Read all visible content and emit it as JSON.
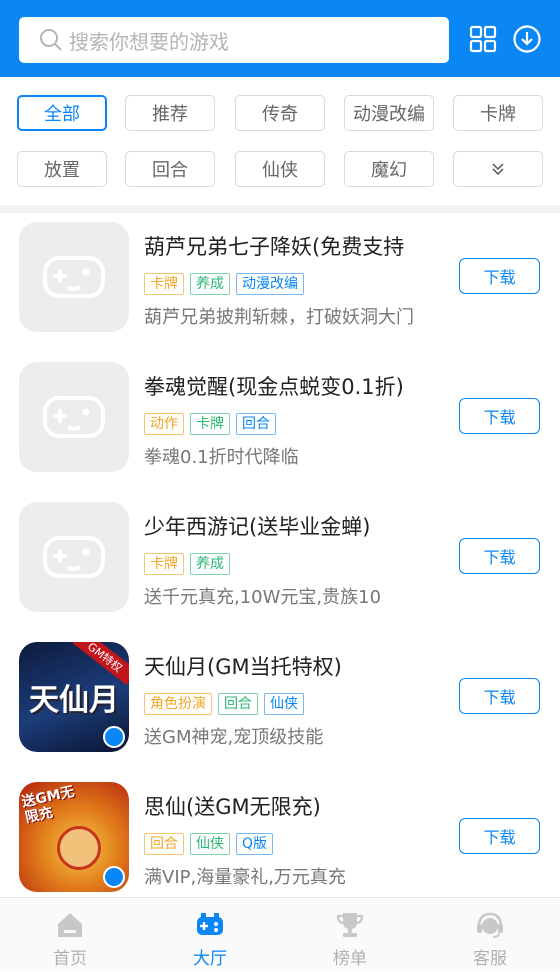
{
  "search": {
    "placeholder": "搜索你想要的游戏"
  },
  "filters": [
    "全部",
    "推荐",
    "传奇",
    "动漫改编",
    "卡牌",
    "放置",
    "回合",
    "仙侠",
    "魔幻"
  ],
  "games": [
    {
      "name": "葫芦兄弟七子降妖(免费支持",
      "tags": [
        {
          "t": "卡牌",
          "c": "orange"
        },
        {
          "t": "养成",
          "c": "green"
        },
        {
          "t": "动漫改编",
          "c": "blue"
        }
      ],
      "desc": "葫芦兄弟披荆斩棘，打破妖洞大门",
      "button": "下载",
      "icon": "gamepad-placeholder-icon"
    },
    {
      "name": "拳魂觉醒(现金点蜕变0.1折)",
      "tags": [
        {
          "t": "动作",
          "c": "orange"
        },
        {
          "t": "卡牌",
          "c": "green"
        },
        {
          "t": "回合",
          "c": "blue"
        }
      ],
      "desc": "拳魂0.1折时代降临",
      "button": "下载",
      "icon": "gamepad-placeholder-icon"
    },
    {
      "name": "少年西游记(送毕业金蝉)",
      "tags": [
        {
          "t": "卡牌",
          "c": "orange"
        },
        {
          "t": "养成",
          "c": "green"
        }
      ],
      "desc": "送千元真充,10W元宝,贵族10",
      "button": "下载",
      "icon": "gamepad-placeholder-icon"
    },
    {
      "name": "天仙月(GM当托特权)",
      "tags": [
        {
          "t": "角色扮演",
          "c": "orange"
        },
        {
          "t": "回合",
          "c": "green"
        },
        {
          "t": "仙侠",
          "c": "blue"
        }
      ],
      "desc": "送GM神宠,宠顶级技能",
      "button": "下载",
      "icon": "tianxianyue-icon",
      "icon_text": "天仙月",
      "icon_badge": "GM特权"
    },
    {
      "name": "思仙(送GM无限充)",
      "tags": [
        {
          "t": "回合",
          "c": "orange"
        },
        {
          "t": "仙侠",
          "c": "green"
        },
        {
          "t": "Q版",
          "c": "blue"
        }
      ],
      "desc": "满VIP,海量豪礼,万元真充",
      "button": "下载",
      "icon": "sixian-icon",
      "icon_text": "送GM无限充"
    }
  ],
  "tabs": [
    {
      "label": "首页",
      "icon": "home-icon",
      "active": false
    },
    {
      "label": "大厅",
      "icon": "gamepad-icon",
      "active": true
    },
    {
      "label": "榜单",
      "icon": "trophy-icon",
      "active": false
    },
    {
      "label": "客服",
      "icon": "headset-icon",
      "active": false
    }
  ],
  "colors": {
    "primary": "#0a86f5",
    "tag_orange": "#f6a623",
    "tag_green": "#2bb673",
    "tag_blue": "#0a86f5"
  }
}
